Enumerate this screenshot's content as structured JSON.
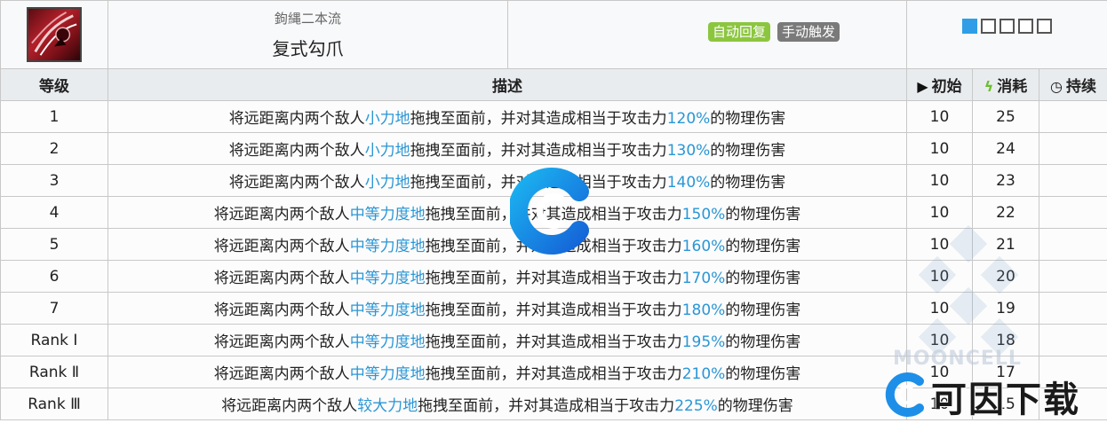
{
  "skill": {
    "icon": "claw-skill-icon",
    "subname": "鉤縄二本流",
    "name": "复式勾爪",
    "tags": [
      "自动回复",
      "手动触发"
    ],
    "level_count": 5,
    "level_selected": 1
  },
  "headers": {
    "level": "等级",
    "desc": "描述",
    "initial": "初始",
    "cost": "消耗",
    "duration": "持续"
  },
  "rows": [
    {
      "level": "1",
      "pre": "将远距离内两个敌人",
      "force": "小力地",
      "mid": "拖拽至面前，并对其造成相当于攻击力",
      "pct": "120%",
      "post": "的物理伤害",
      "initial": "10",
      "cost": "25",
      "duration": ""
    },
    {
      "level": "2",
      "pre": "将远距离内两个敌人",
      "force": "小力地",
      "mid": "拖拽至面前，并对其造成相当于攻击力",
      "pct": "130%",
      "post": "的物理伤害",
      "initial": "10",
      "cost": "24",
      "duration": ""
    },
    {
      "level": "3",
      "pre": "将远距离内两个敌人",
      "force": "小力地",
      "mid": "拖拽至面前，并对其造成相当于攻击力",
      "pct": "140%",
      "post": "的物理伤害",
      "initial": "10",
      "cost": "23",
      "duration": ""
    },
    {
      "level": "4",
      "pre": "将远距离内两个敌人",
      "force": "中等力度地",
      "mid": "拖拽至面前，并对其造成相当于攻击力",
      "pct": "150%",
      "post": "的物理伤害",
      "initial": "10",
      "cost": "22",
      "duration": ""
    },
    {
      "level": "5",
      "pre": "将远距离内两个敌人",
      "force": "中等力度地",
      "mid": "拖拽至面前，并对其造成相当于攻击力",
      "pct": "160%",
      "post": "的物理伤害",
      "initial": "10",
      "cost": "21",
      "duration": ""
    },
    {
      "level": "6",
      "pre": "将远距离内两个敌人",
      "force": "中等力度地",
      "mid": "拖拽至面前，并对其造成相当于攻击力",
      "pct": "170%",
      "post": "的物理伤害",
      "initial": "10",
      "cost": "20",
      "duration": ""
    },
    {
      "level": "7",
      "pre": "将远距离内两个敌人",
      "force": "中等力度地",
      "mid": "拖拽至面前，并对其造成相当于攻击力",
      "pct": "180%",
      "post": "的物理伤害",
      "initial": "10",
      "cost": "19",
      "duration": ""
    },
    {
      "level": "Rank Ⅰ",
      "pre": "将远距离内两个敌人",
      "force": "中等力度地",
      "mid": "拖拽至面前，并对其造成相当于攻击力",
      "pct": "195%",
      "post": "的物理伤害",
      "initial": "10",
      "cost": "18",
      "duration": ""
    },
    {
      "level": "Rank Ⅱ",
      "pre": "将远距离内两个敌人",
      "force": "中等力度地",
      "mid": "拖拽至面前，并对其造成相当于攻击力",
      "pct": "210%",
      "post": "的物理伤害",
      "initial": "10",
      "cost": "17",
      "duration": ""
    },
    {
      "level": "Rank Ⅲ",
      "pre": "将远距离内两个敌人",
      "force": "较大力地",
      "mid": "拖拽至面前，并对其造成相当于攻击力",
      "pct": "225%",
      "post": "的物理伤害",
      "initial": "10",
      "cost": "15",
      "duration": ""
    }
  ],
  "watermarks": {
    "moon_text": "MOONCELL",
    "brand_text": "可因下载"
  },
  "colors": {
    "highlight": "#2a96d6",
    "tag_auto": "#8cc63f",
    "tag_manual": "#7a7a7a",
    "level_on": "#2f9ee6",
    "header_bg": "#e9ecef"
  }
}
